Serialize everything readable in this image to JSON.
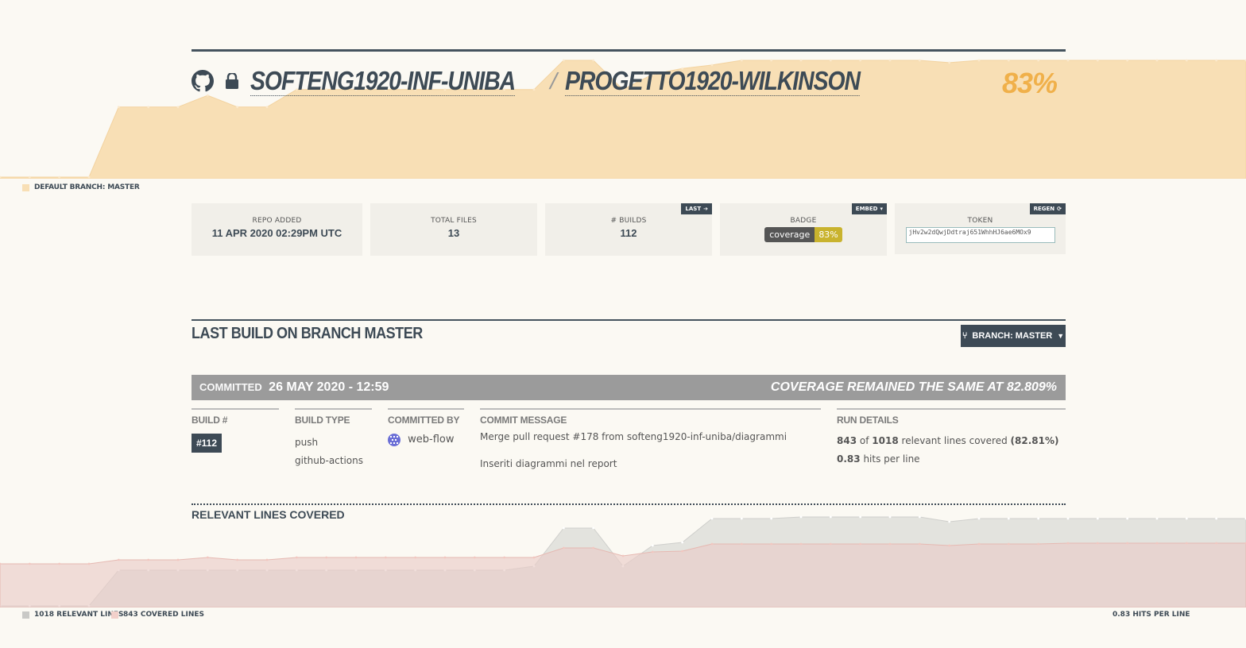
{
  "header": {
    "owner": "SOFTENG1920-INF-UNIBA",
    "separator": "/",
    "repo": "PROGETTO1920-WILKINSON",
    "coverage_percent": "83%",
    "icons": [
      "github-icon",
      "lock-icon"
    ]
  },
  "top_chart_legend": "DEFAULT BRANCH: MASTER",
  "stats": {
    "repo_added": {
      "label": "REPO ADDED",
      "value": "11 APR 2020 02:29PM UTC"
    },
    "total_files": {
      "label": "TOTAL FILES",
      "value": "13"
    },
    "builds": {
      "label": "# BUILDS",
      "value": "112",
      "tag": "LAST"
    },
    "badge": {
      "label": "BADGE",
      "left": "coverage",
      "right": "83%",
      "tag": "EMBED"
    },
    "token": {
      "label": "TOKEN",
      "value": "jHv2w2dQwjDdtraj651WhhHJ6ae6MOx9",
      "tag": "REGEN"
    }
  },
  "last_build": {
    "title": "LAST BUILD ON BRANCH MASTER",
    "branch_button": "BRANCH: MASTER",
    "committed_label": "COMMITTED",
    "committed_date": "26 MAY 2020 - 12:59",
    "coverage_status": "COVERAGE REMAINED THE SAME AT 82.809%",
    "build_number_header": "BUILD #",
    "build_number": "#112",
    "build_type_header": "BUILD TYPE",
    "build_types": [
      "push",
      "github-actions"
    ],
    "committed_by_header": "COMMITTED BY",
    "committer": "web-flow",
    "commit_message_header": "COMMIT MESSAGE",
    "commit_message_line1": "Merge pull request #178 from softeng1920-inf-uniba/diagrammi",
    "commit_message_line2": "Inseriti diagrammi nel report",
    "run_details_header": "RUN DETAILS",
    "covered": "843",
    "of": "of",
    "relevant": "1018",
    "relevant_text": "relevant lines covered",
    "percent_text": "(82.81%)",
    "hits": "0.83",
    "hits_text": "hits per line"
  },
  "lines_chart": {
    "title": "RELEVANT LINES COVERED",
    "legend_relevant": "1018 RELEVANT LINES",
    "legend_covered": "843 COVERED LINES",
    "legend_hits": "0.83 HITS PER LINE"
  },
  "colors": {
    "accent": "#f0b04a",
    "coverage_fill": "#f8dfb5",
    "relevant_fill": "#e3e3de",
    "covered_fill": "#f2d9d5",
    "dark": "#3d4a55"
  },
  "chart_data": [
    {
      "type": "area",
      "name": "coverage",
      "series": [
        {
          "values": [
            0,
            0,
            0,
            0,
            60,
            60,
            60,
            70,
            60,
            60,
            75,
            75,
            75,
            75,
            75,
            75,
            75,
            75,
            75,
            100,
            100,
            75,
            88,
            93,
            96,
            100,
            100,
            100,
            100,
            100,
            100,
            100,
            98,
            100,
            100,
            100,
            100,
            100,
            100,
            100,
            100,
            100,
            100
          ]
        }
      ]
    },
    {
      "type": "area",
      "series": [
        {
          "values": [
            0,
            0,
            0,
            0,
            45,
            45,
            45,
            45,
            45,
            45,
            45,
            45,
            45,
            45,
            45,
            45,
            45,
            45,
            50,
            98,
            98,
            50,
            76,
            80,
            110,
            110,
            110,
            112,
            112,
            112,
            112,
            112,
            106,
            110,
            110,
            110,
            110,
            110,
            110,
            110,
            110,
            110,
            110
          ]
        },
        {
          "values": [
            40,
            40,
            40,
            40,
            45,
            45,
            45,
            48,
            45,
            45,
            48,
            48,
            48,
            48,
            48,
            48,
            48,
            48,
            48,
            60,
            60,
            50,
            55,
            56,
            65,
            65,
            65,
            65,
            65,
            65,
            65,
            65,
            63,
            65,
            65,
            65,
            66,
            66,
            66,
            66,
            66,
            66,
            66
          ]
        }
      ]
    }
  ]
}
